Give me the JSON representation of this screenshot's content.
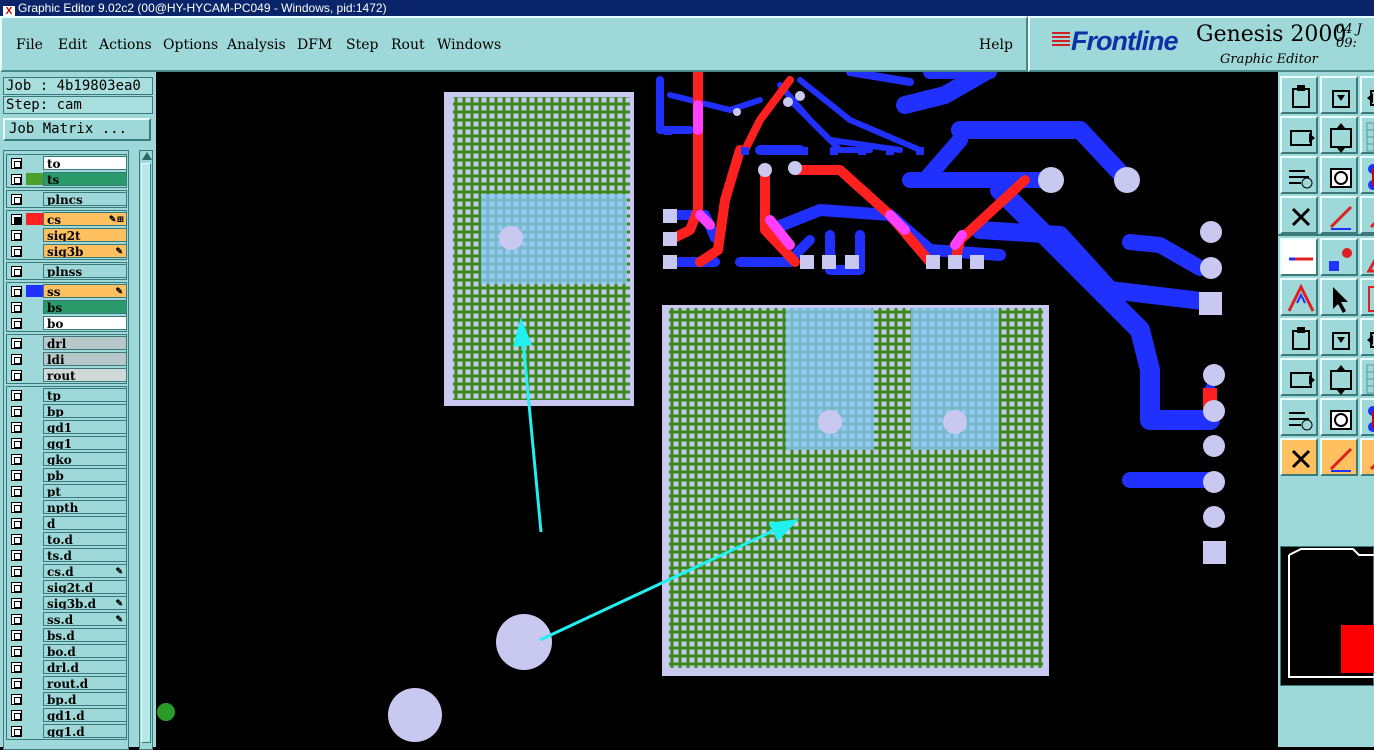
{
  "window": {
    "title": "Graphic Editor 9.02c2 (00@HY-HYCAM-PC049 - Windows, pid:1472)"
  },
  "menu": {
    "items": [
      "File",
      "Edit",
      "Actions",
      "Options",
      "Analysis",
      "DFM",
      "Step",
      "Rout",
      "Windows"
    ],
    "help": "Help"
  },
  "brand": {
    "logo": "Frontline",
    "product": "Genesis 2000",
    "subtitle": "Graphic Editor",
    "date_line1": "04 J",
    "date_line2": "09:"
  },
  "job": {
    "job_label": "Job : 4b19803ea0",
    "step_label": "Step: cam",
    "matrix_button": "Job Matrix ..."
  },
  "layer_groups": [
    {
      "layers": [
        {
          "name": "to",
          "color": "#ffffff",
          "swatch": "",
          "checked": false,
          "editable": false
        },
        {
          "name": "ts",
          "color": "#2a9a6a",
          "swatch": "#4aa02a",
          "checked": false,
          "editable": false
        }
      ]
    },
    {
      "layers": [
        {
          "name": "plncs",
          "color": "#9ed8d8",
          "swatch": "",
          "checked": false,
          "editable": false
        }
      ]
    },
    {
      "layers": [
        {
          "name": "cs",
          "color": "#ffc060",
          "swatch": "#ff2020",
          "checked": true,
          "editable": true,
          "work": true
        },
        {
          "name": "sig2t",
          "color": "#ffc060",
          "swatch": "",
          "checked": false,
          "editable": false
        },
        {
          "name": "sig3b",
          "color": "#ffc060",
          "swatch": "",
          "checked": false,
          "editable": true
        }
      ]
    },
    {
      "layers": [
        {
          "name": "plnss",
          "color": "#9ed8d8",
          "swatch": "",
          "checked": false,
          "editable": false
        }
      ]
    },
    {
      "layers": [
        {
          "name": "ss",
          "color": "#ffc060",
          "swatch": "#2030ff",
          "checked": false,
          "editable": true
        },
        {
          "name": "bs",
          "color": "#2a9a6a",
          "swatch": "",
          "checked": false,
          "editable": false
        },
        {
          "name": "bo",
          "color": "#ffffff",
          "swatch": "",
          "checked": false,
          "editable": false
        }
      ]
    },
    {
      "layers": [
        {
          "name": "drl",
          "color": "#b8c8c8",
          "swatch": "",
          "checked": false,
          "editable": false
        },
        {
          "name": "ldi",
          "color": "#b8c8c8",
          "swatch": "",
          "checked": false,
          "editable": false
        },
        {
          "name": "rout",
          "color": "#d0d8d8",
          "swatch": "",
          "checked": false,
          "editable": false
        }
      ]
    },
    {
      "layers": [
        {
          "name": "tp",
          "color": "#9ed8d8",
          "swatch": "",
          "checked": false,
          "editable": false
        },
        {
          "name": "bp",
          "color": "#9ed8d8",
          "swatch": "",
          "checked": false,
          "editable": false
        },
        {
          "name": "gd1",
          "color": "#9ed8d8",
          "swatch": "",
          "checked": false,
          "editable": false
        },
        {
          "name": "gg1",
          "color": "#9ed8d8",
          "swatch": "",
          "checked": false,
          "editable": false
        },
        {
          "name": "gko",
          "color": "#9ed8d8",
          "swatch": "",
          "checked": false,
          "editable": false
        },
        {
          "name": "pb",
          "color": "#9ed8d8",
          "swatch": "",
          "checked": false,
          "editable": false
        },
        {
          "name": "pt",
          "color": "#9ed8d8",
          "swatch": "",
          "checked": false,
          "editable": false
        },
        {
          "name": "npth",
          "color": "#9ed8d8",
          "swatch": "",
          "checked": false,
          "editable": false
        },
        {
          "name": "d",
          "color": "#9ed8d8",
          "swatch": "",
          "checked": false,
          "editable": false
        },
        {
          "name": "to.d",
          "color": "#9ed8d8",
          "swatch": "",
          "checked": false,
          "editable": false
        },
        {
          "name": "ts.d",
          "color": "#9ed8d8",
          "swatch": "",
          "checked": false,
          "editable": false
        },
        {
          "name": "cs.d",
          "color": "#9ed8d8",
          "swatch": "",
          "checked": false,
          "editable": true
        },
        {
          "name": "sig2t.d",
          "color": "#9ed8d8",
          "swatch": "",
          "checked": false,
          "editable": false
        },
        {
          "name": "sig3b.d",
          "color": "#9ed8d8",
          "swatch": "",
          "checked": false,
          "editable": true
        },
        {
          "name": "ss.d",
          "color": "#9ed8d8",
          "swatch": "",
          "checked": false,
          "editable": true
        },
        {
          "name": "bs.d",
          "color": "#9ed8d8",
          "swatch": "",
          "checked": false,
          "editable": false
        },
        {
          "name": "bo.d",
          "color": "#9ed8d8",
          "swatch": "",
          "checked": false,
          "editable": false
        },
        {
          "name": "drl.d",
          "color": "#9ed8d8",
          "swatch": "",
          "checked": false,
          "editable": false
        },
        {
          "name": "rout.d",
          "color": "#9ed8d8",
          "swatch": "",
          "checked": false,
          "editable": false
        },
        {
          "name": "bp.d",
          "color": "#9ed8d8",
          "swatch": "",
          "checked": false,
          "editable": false
        },
        {
          "name": "gd1.d",
          "color": "#9ed8d8",
          "swatch": "",
          "checked": false,
          "editable": false
        },
        {
          "name": "gg1.d",
          "color": "#9ed8d8",
          "swatch": "",
          "checked": false,
          "editable": false
        }
      ]
    }
  ],
  "tools": [
    "home-view-icon",
    "pan-icon",
    "zoom-in-icon",
    "zoom-out-icon",
    "zoom-left-icon",
    "zoom-right-icon",
    "fit-all-icon",
    "fit-profile-icon",
    "measure-icon",
    "grid-icon",
    "snap-icon",
    "pad-feature-icon",
    "shape-icon",
    "text-icon",
    "net-icon",
    "cross-icon",
    "select-icon",
    "line-icon",
    "arc-icon",
    "circle-icon",
    "align-icon",
    "horizontal-line-icon",
    "vertical-line-icon",
    "triangle-icon",
    "poly-icon",
    "poly-2-icon",
    "pointer-icon",
    "select-box-icon",
    "pointer-2-icon"
  ],
  "colors": {
    "panel": "#9ed8d8",
    "copper_top": "#ff2020",
    "copper_bottom": "#2030ff",
    "overlap": "#ff40ff",
    "pad": "#c8c8f0",
    "solder_mask": "#4aa02a",
    "annotation_arrow": "#20f0f0"
  }
}
